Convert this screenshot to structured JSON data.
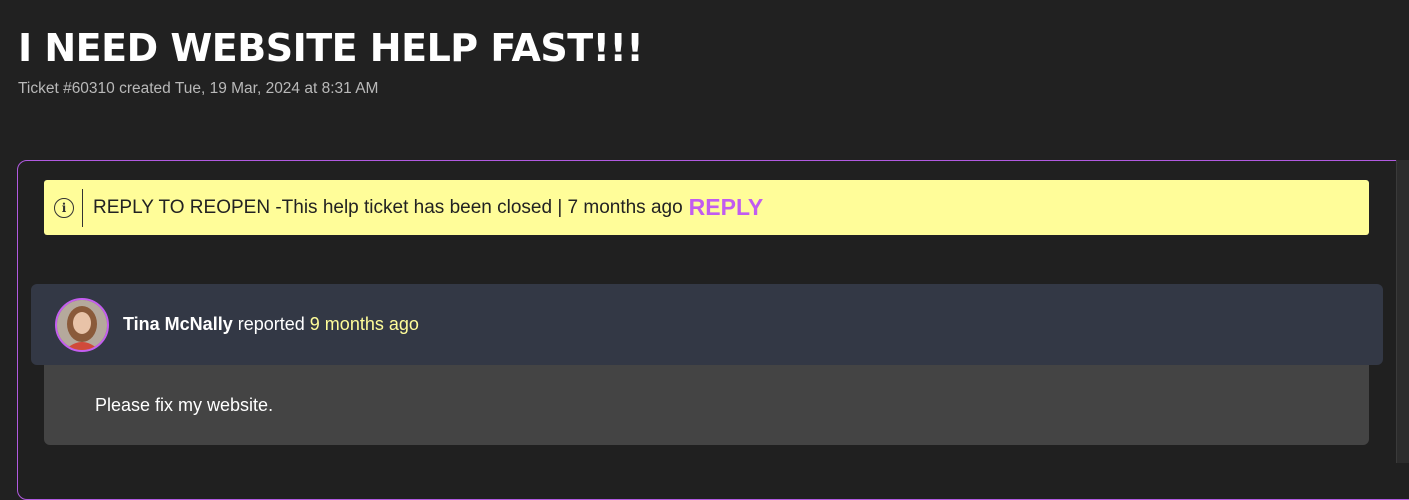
{
  "ticket": {
    "title": "I NEED WEBSITE HELP FAST!!!",
    "subtitle": "Ticket #60310 created Tue, 19 Mar, 2024 at 8:31 AM"
  },
  "notice": {
    "icon": "info-icon",
    "text": "REPLY TO REOPEN -This help ticket has been closed | 7 months ago",
    "reply_label": "REPLY",
    "background": "#fffd99",
    "reply_color": "#c15cf0"
  },
  "entry": {
    "author": "Tina McNally",
    "verb": "reported",
    "time": "9 months ago",
    "message": "Please fix my website."
  }
}
